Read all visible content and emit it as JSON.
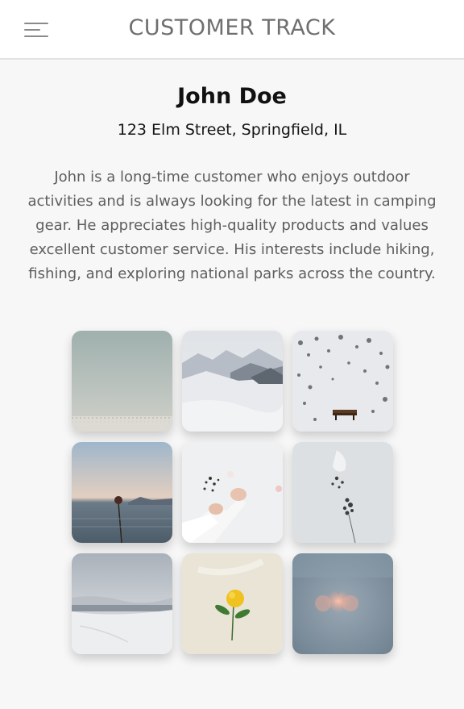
{
  "header": {
    "title": "CUSTOMER TRACK",
    "menu_icon": "hamburger-menu-icon"
  },
  "profile": {
    "name": "John Doe",
    "address": "123 Elm Street, Springfield, IL",
    "bio": "John is a long-time customer who enjoys outdoor activities and is always looking for the latest in camping gear. He appreciates high-quality products and values excellent customer service. His interests include hiking, fishing, and exploring national parks across the country."
  },
  "gallery": {
    "photos": [
      "misty-sea-horizon-photo",
      "snowy-mountain-ridge-photo",
      "snow-covered-bench-photo",
      "sunset-water-flower-photo",
      "hands-holding-dried-flowers-photo",
      "dried-flower-on-white-photo",
      "snowy-beach-landscape-photo",
      "yellow-flower-on-cream-photo",
      "blurred-heart-bokeh-photo"
    ]
  },
  "colors": {
    "header_bg": "#ffffff",
    "page_bg": "#f7f7f7",
    "title_text": "#6f6f6f",
    "bio_text": "#5e5e5e"
  }
}
